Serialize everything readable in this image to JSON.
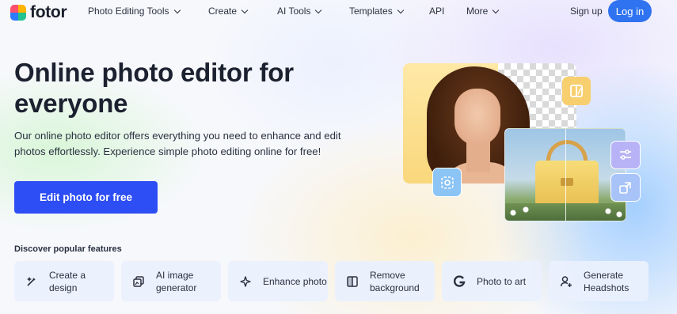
{
  "nav": {
    "logo_text": "fotor",
    "items": [
      {
        "label": "Photo Editing Tools",
        "dropdown": true
      },
      {
        "label": "Create",
        "dropdown": true
      },
      {
        "label": "AI Tools",
        "dropdown": true
      },
      {
        "label": "Templates",
        "dropdown": true
      },
      {
        "label": "API",
        "dropdown": false
      },
      {
        "label": "More",
        "dropdown": true
      }
    ],
    "signup": "Sign up",
    "login": "Log in"
  },
  "hero": {
    "title": "Online photo editor for everyone",
    "description": "Our online photo editor offers everything you need to enhance and edit photos effortlessly. Experience simple photo editing online for free!",
    "cta": "Edit photo for free"
  },
  "discover": {
    "heading": "Discover popular features",
    "features": [
      {
        "label": "Create a design",
        "icon": "magic-wand-icon"
      },
      {
        "label": "AI image generator",
        "icon": "image-stack-icon"
      },
      {
        "label": "Enhance photo",
        "icon": "sparkle-icon"
      },
      {
        "label": "Remove background",
        "icon": "cutout-icon"
      },
      {
        "label": "Photo to art",
        "icon": "g-logo-icon"
      },
      {
        "label": "Generate Headshots",
        "icon": "person-plus-icon"
      }
    ]
  },
  "colors": {
    "primary_button": "#2d4df5",
    "login_button": "#2f73f0",
    "feature_card": "#eaf0fd"
  }
}
